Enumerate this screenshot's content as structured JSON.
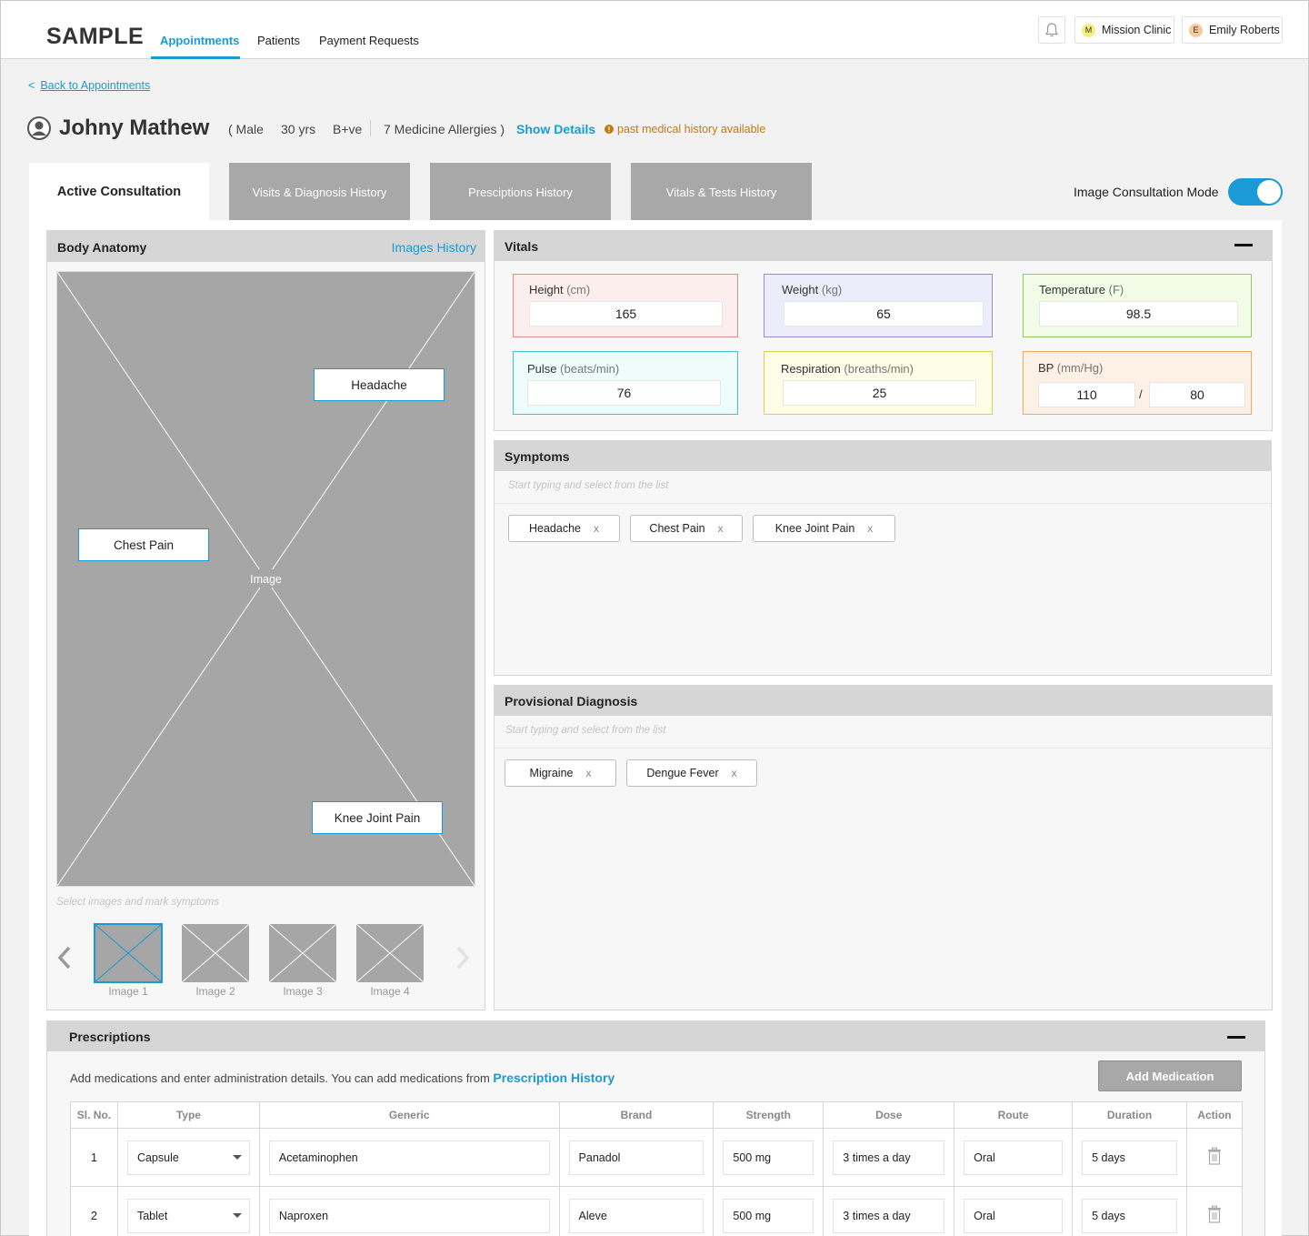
{
  "header": {
    "logo": "SAMPLE",
    "nav": [
      "Appointments",
      "Patients",
      "Payment Requests"
    ],
    "clinic_initial": "M",
    "clinic": "Mission Clinic",
    "user_initial": "E",
    "user": "Emily Roberts"
  },
  "patient": {
    "back_arrow": "<",
    "back": "Back to Appointments",
    "name": "Johny Mathew",
    "gender": "( Male",
    "age": "30 yrs",
    "blood": "B+ve",
    "allergies": "7 Medicine Allergies )",
    "show_details": "Show Details",
    "history_icon": "!",
    "history_note": "past medical history available"
  },
  "tabs": [
    "Active Consultation",
    "Visits & Diagnosis History",
    "Presciptions History",
    "Vitals & Tests History"
  ],
  "mode": {
    "label": "Image Consultation Mode",
    "on": true
  },
  "anatomy": {
    "title": "Body Anatomy",
    "history_link": "Images History",
    "image_label": "Image",
    "tags": [
      "Headache",
      "Chest Pain",
      "Knee Joint Pain"
    ],
    "hint": "Select images and mark symptoms",
    "thumbnails": [
      "Image 1",
      "Image 2",
      "Image 3",
      "Image 4"
    ]
  },
  "vitals": {
    "title": "Vitals",
    "items": [
      {
        "label": "Height",
        "unit": "(cm)",
        "value": "165"
      },
      {
        "label": "Weight",
        "unit": "(kg)",
        "value": "65"
      },
      {
        "label": "Temperature",
        "unit": "(F)",
        "value": "98.5"
      },
      {
        "label": "Pulse",
        "unit": "(beats/min)",
        "value": "76"
      },
      {
        "label": "Respiration",
        "unit": "(breaths/min)",
        "value": "25"
      },
      {
        "label": "BP",
        "unit": "(mm/Hg)",
        "systolic": "110",
        "slash": "/",
        "diastolic": "80"
      }
    ]
  },
  "symptoms": {
    "title": "Symptoms",
    "placeholder": "Start typing and select from the list",
    "chips": [
      "Headache",
      "Chest Pain",
      "Knee Joint Pain"
    ]
  },
  "diagnosis": {
    "title": "Provisional Diagnosis",
    "placeholder": "Start typing and select from the list",
    "chips": [
      "Migraine",
      "Dengue Fever"
    ]
  },
  "chip_remove": "x",
  "prescriptions": {
    "title": "Prescriptions",
    "desc": "Add medications and enter administration details. You can add medications from",
    "desc_link": "Prescription History",
    "add_button": "Add Medication",
    "columns": [
      "Sl. No.",
      "Type",
      "Generic",
      "Brand",
      "Strength",
      "Dose",
      "Route",
      "Duration",
      "Action"
    ],
    "rows": [
      {
        "sl": "1",
        "type": "Capsule",
        "generic": "Acetaminophen",
        "brand": "Panadol",
        "strength": "500 mg",
        "dose": "3 times a day",
        "route": "Oral",
        "duration": "5 days"
      },
      {
        "sl": "2",
        "type": "Tablet",
        "generic": "Naproxen",
        "brand": "Aleve",
        "strength": "500 mg",
        "dose": "3 times a day",
        "route": "Oral",
        "duration": "5 days"
      }
    ]
  },
  "colors": {
    "accent": "#1a9ad6",
    "height_bg": "#fdeeee",
    "height_border": "#e88a8a",
    "weight_bg": "#ececfb",
    "weight_border": "#8f8fd6",
    "temp_bg": "#f1fbe6",
    "temp_border": "#8fcc5c",
    "pulse_bg": "#eefcfc",
    "pulse_border": "#3fc4cc",
    "resp_bg": "#fdfde8",
    "resp_border": "#d8d14a",
    "bp_bg": "#fdf1e6",
    "bp_border": "#f0a860"
  }
}
